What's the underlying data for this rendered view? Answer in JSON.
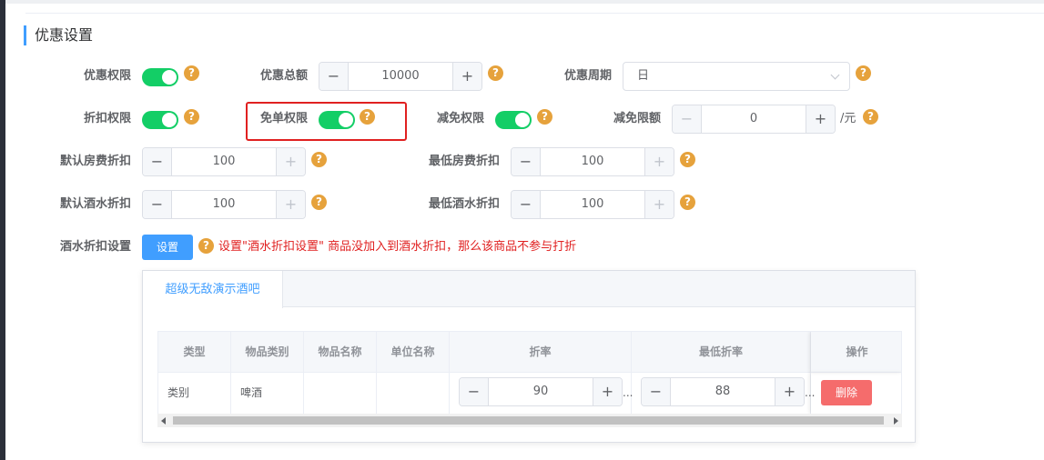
{
  "section": {
    "title": "优惠设置"
  },
  "row1": {
    "privilege_label": "优惠权限",
    "total_label": "优惠总额",
    "total_value": "10000",
    "period_label": "优惠周期",
    "period_value": "日"
  },
  "row2": {
    "discount_label": "折扣权限",
    "free_label": "免单权限",
    "reduce_label": "减免权限",
    "reduce_limit_label": "减免限额",
    "reduce_limit_value": "0",
    "reduce_unit": "/元"
  },
  "row3": {
    "default_room_label": "默认房费折扣",
    "default_room_value": "100",
    "min_room_label": "最低房费折扣",
    "min_room_value": "100"
  },
  "row4": {
    "default_drink_label": "默认酒水折扣",
    "default_drink_value": "100",
    "min_drink_label": "最低酒水折扣",
    "min_drink_value": "100"
  },
  "row5": {
    "drink_setting_label": "酒水折扣设置",
    "set_button": "设置",
    "hint": "设置\"酒水折扣设置\" 商品没加入到酒水折扣，那么该商品不参与打折"
  },
  "panel": {
    "tab_label": "超级无敌演示酒吧",
    "columns": [
      "类型",
      "物品类别",
      "物品名称",
      "单位名称",
      "折率",
      "最低折率",
      "操作"
    ],
    "row": {
      "type": "类别",
      "category": "啤酒",
      "name": "",
      "unit": "",
      "rate": "90",
      "min_rate": "88",
      "delete_button": "删除"
    }
  },
  "icons": {
    "help": "question-circle-icon",
    "minus": "minus-icon",
    "plus": "plus-icon",
    "dropdown": "chevron-down-icon"
  },
  "glyphs": {
    "help": "?",
    "minus": "−",
    "plus": "+",
    "ellipsis": "..."
  },
  "colors": {
    "accent": "#409eff",
    "switch_on": "#13ce66",
    "help": "#e6a23c",
    "danger": "#f56c6c",
    "highlight": "#e02020"
  }
}
